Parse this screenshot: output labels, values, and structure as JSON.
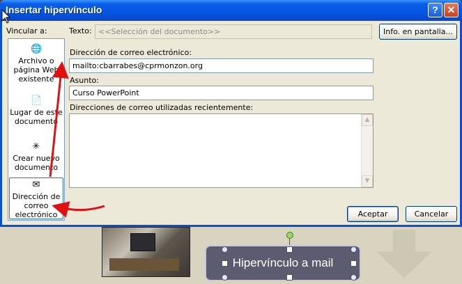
{
  "dialog": {
    "title": "Insertar hipervínculo",
    "help_button": "?",
    "close_button": "✕"
  },
  "link_to": {
    "label": "Vincular a:",
    "items": [
      {
        "label": "Archivo o página Web existente",
        "icon": "web-page-icon"
      },
      {
        "label": "Lugar de este documento",
        "icon": "document-place-icon"
      },
      {
        "label": "Crear nuevo documento",
        "icon": "new-document-icon"
      },
      {
        "label": "Dirección de correo electrónico",
        "icon": "email-address-icon",
        "selected": true
      }
    ]
  },
  "text_field": {
    "label": "Texto:",
    "value": "<<Selección del documento>>",
    "tooltip_button": "Info. en pantalla..."
  },
  "email": {
    "label": "Dirección de correo electrónico:",
    "value": "mailto:cbarrabes@cprmonzon.org"
  },
  "subject": {
    "label": "Asunto:",
    "value": "Curso PowerPoint"
  },
  "recent": {
    "label": "Direcciones de correo utilizadas recientemente:",
    "items": []
  },
  "buttons": {
    "accept": "Aceptar",
    "cancel": "Cancelar"
  },
  "slide": {
    "shape_text": "Hipervínculo a mail"
  },
  "colors": {
    "titlebar": "#0554e2",
    "dialog_bg": "#ece9d8",
    "annotation_arrow": "#e01010"
  }
}
